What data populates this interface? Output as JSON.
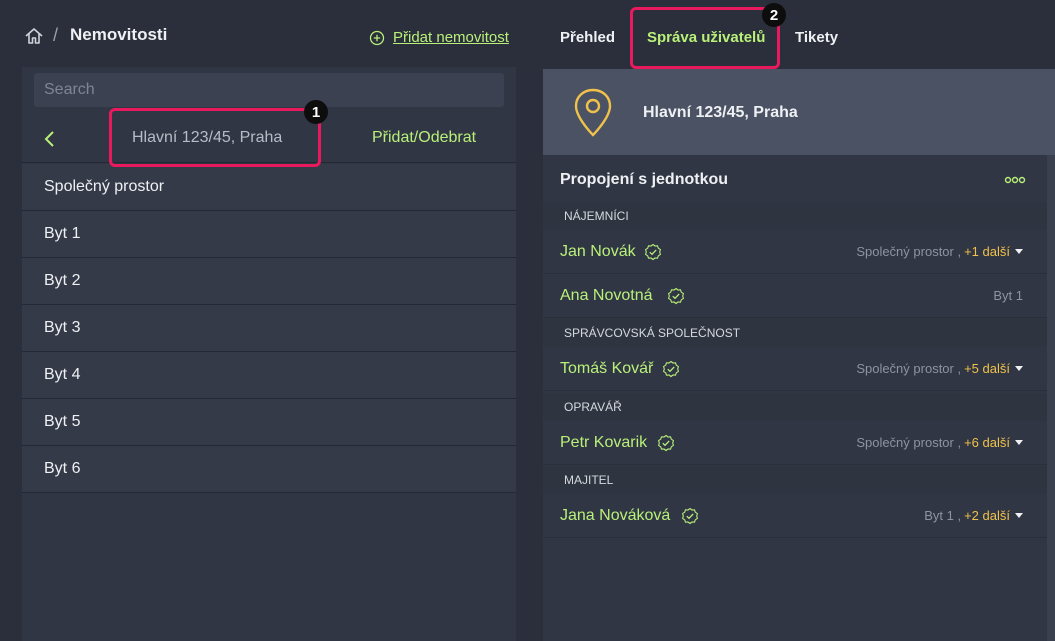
{
  "breadcrumb": {
    "title": "Nemovitosti",
    "separator": "/"
  },
  "add_property_label": "Přidat nemovitost",
  "tabs": [
    {
      "label": "Přehled"
    },
    {
      "label": "Správa uživatelů"
    },
    {
      "label": "Tikety"
    }
  ],
  "left": {
    "search_placeholder": "Search",
    "current_property": "Hlavní 123/45, Praha",
    "add_remove_label": "Přidat/Odebrat",
    "units": [
      "Společný prostor",
      "Byt 1",
      "Byt 2",
      "Byt 3",
      "Byt 4",
      "Byt 5",
      "Byt 6"
    ]
  },
  "right": {
    "property_name": "Hlavní 123/45, Praha",
    "section_title": "Propojení s jednotkou",
    "groups": [
      {
        "label": "NÁJEMNÍCI",
        "people": [
          {
            "name": "Jan Novák",
            "units": "Společný prostor ,",
            "more": "+1 další",
            "has_more": true
          },
          {
            "name": "Ana Novotná",
            "units": "Byt 1",
            "more": "",
            "has_more": false
          }
        ]
      },
      {
        "label": "SPRÁVCOVSKÁ SPOLEČNOST",
        "people": [
          {
            "name": "Tomáš Kovář",
            "units": "Společný prostor ,",
            "more": "+5 další",
            "has_more": true
          }
        ]
      },
      {
        "label": "OPRAVÁŘ",
        "people": [
          {
            "name": "Petr Kovarik",
            "units": "Společný prostor ,",
            "more": "+6 další",
            "has_more": true
          }
        ]
      },
      {
        "label": "MAJITEL",
        "people": [
          {
            "name": "Jana Nováková",
            "units": "Byt 1 ,",
            "more": "+2 další",
            "has_more": true
          }
        ]
      }
    ]
  },
  "annotations": [
    {
      "label": "1"
    },
    {
      "label": "2"
    }
  ],
  "colors": {
    "accent": "#b9f07a",
    "highlight": "#e8195c",
    "more_link": "#f0c14b",
    "pin": "#f0c14b"
  },
  "icons": {
    "home": "home-icon",
    "add": "plus-circle-icon",
    "back": "chevron-left-icon",
    "pin": "map-pin-icon",
    "verified": "check-circle-icon",
    "more": "more-dots-icon",
    "caret": "caret-down-icon"
  }
}
